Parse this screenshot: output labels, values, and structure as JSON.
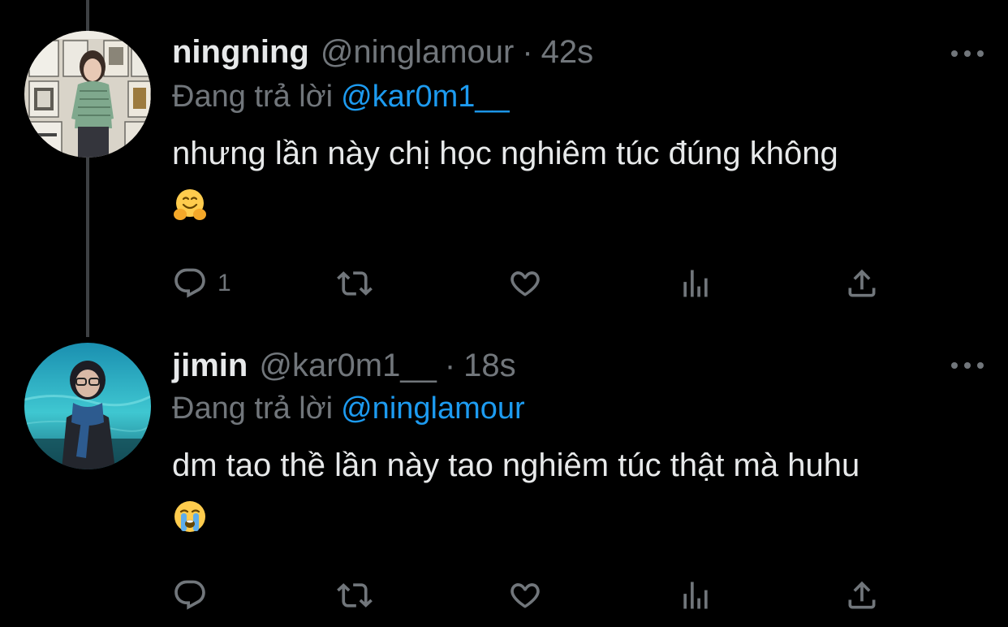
{
  "colors": {
    "background": "#000000",
    "primary_text": "#e7e9ea",
    "secondary_text": "#71767b",
    "link": "#1d9bf0",
    "thread_line": "#3e4144"
  },
  "tweets": [
    {
      "name": "ningning",
      "handle": "@ninglamour",
      "separator": "·",
      "time": "42s",
      "reply_prefix": "Đang trả lời",
      "reply_to": "@kar0m1__",
      "text": "nhưng lần này chị học nghiêm túc đúng không",
      "emoji": "hugging-face-emoji",
      "reply_count": "1",
      "icons": [
        "reply-icon",
        "retweet-icon",
        "like-icon",
        "views-icon",
        "share-icon",
        "more-icon"
      ]
    },
    {
      "name": "jimin",
      "handle": "@kar0m1__",
      "separator": "·",
      "time": "18s",
      "reply_prefix": "Đang trả lời",
      "reply_to": "@ninglamour",
      "text": "dm tao thề lần này tao nghiêm túc thật mà huhu",
      "emoji": "loudly-crying-face-emoji",
      "reply_count": "",
      "icons": [
        "reply-icon",
        "retweet-icon",
        "like-icon",
        "views-icon",
        "share-icon",
        "more-icon"
      ]
    }
  ]
}
